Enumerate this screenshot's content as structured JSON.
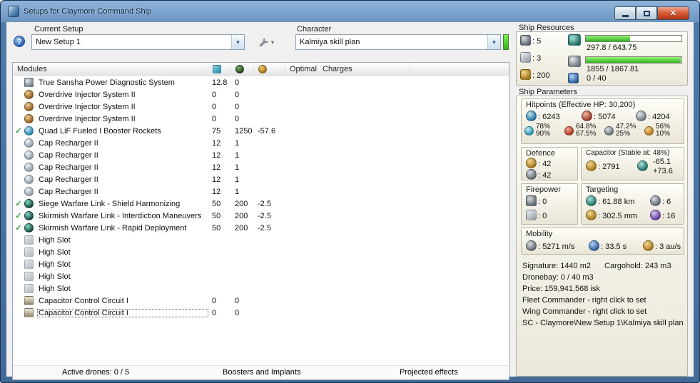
{
  "window": {
    "title": "Setups for Claymore Command Ship"
  },
  "toolbar": {
    "current_setup_label": "Current Setup",
    "setup_value": "New Setup 1",
    "character_label": "Character",
    "character_value": "Kalmiya skill plan",
    "help_glyph": "?"
  },
  "modules": {
    "header_label": "Modules",
    "optimal_label": "Optimal",
    "charges_label": "Charges",
    "rows": [
      {
        "check": "",
        "icon": "power-diagnostic",
        "name": "True Sansha Power Diagnostic System",
        "cpu": "12.8",
        "pg": "0",
        "cap": "",
        "optimal": "",
        "charges": ""
      },
      {
        "check": "",
        "icon": "overdrive",
        "name": "Overdrive Injector System II",
        "cpu": "0",
        "pg": "0",
        "cap": "",
        "optimal": "",
        "charges": ""
      },
      {
        "check": "",
        "icon": "overdrive",
        "name": "Overdrive Injector System II",
        "cpu": "0",
        "pg": "0",
        "cap": "",
        "optimal": "",
        "charges": ""
      },
      {
        "check": "",
        "icon": "overdrive",
        "name": "Overdrive Injector System II",
        "cpu": "0",
        "pg": "0",
        "cap": "",
        "optimal": "",
        "charges": ""
      },
      {
        "check": "✓",
        "icon": "booster",
        "name": "Quad LiF Fueled I Booster Rockets",
        "cpu": "75",
        "pg": "1250",
        "cap": "-57.6",
        "optimal": "",
        "charges": ""
      },
      {
        "check": "",
        "icon": "cap-recharger",
        "name": "Cap Recharger II",
        "cpu": "12",
        "pg": "1",
        "cap": "",
        "optimal": "",
        "charges": ""
      },
      {
        "check": "",
        "icon": "cap-recharger",
        "name": "Cap Recharger II",
        "cpu": "12",
        "pg": "1",
        "cap": "",
        "optimal": "",
        "charges": ""
      },
      {
        "check": "",
        "icon": "cap-recharger",
        "name": "Cap Recharger II",
        "cpu": "12",
        "pg": "1",
        "cap": "",
        "optimal": "",
        "charges": ""
      },
      {
        "check": "",
        "icon": "cap-recharger",
        "name": "Cap Recharger II",
        "cpu": "12",
        "pg": "1",
        "cap": "",
        "optimal": "",
        "charges": ""
      },
      {
        "check": "",
        "icon": "cap-recharger",
        "name": "Cap Recharger II",
        "cpu": "12",
        "pg": "1",
        "cap": "",
        "optimal": "",
        "charges": ""
      },
      {
        "check": "✓",
        "icon": "warfare-link",
        "name": "Siege Warfare Link - Shield Harmonizing",
        "cpu": "50",
        "pg": "200",
        "cap": "-2.5",
        "optimal": "",
        "charges": ""
      },
      {
        "check": "✓",
        "icon": "warfare-link",
        "name": "Skirmish Warfare Link - Interdiction Maneuvers",
        "cpu": "50",
        "pg": "200",
        "cap": "-2.5",
        "optimal": "",
        "charges": ""
      },
      {
        "check": "✓",
        "icon": "warfare-link",
        "name": "Skirmish Warfare Link - Rapid Deployment",
        "cpu": "50",
        "pg": "200",
        "cap": "-2.5",
        "optimal": "",
        "charges": ""
      },
      {
        "check": "",
        "icon": "high-slot",
        "name": "High Slot",
        "cpu": "",
        "pg": "",
        "cap": "",
        "optimal": "",
        "charges": ""
      },
      {
        "check": "",
        "icon": "high-slot",
        "name": "High Slot",
        "cpu": "",
        "pg": "",
        "cap": "",
        "optimal": "",
        "charges": ""
      },
      {
        "check": "",
        "icon": "high-slot",
        "name": "High Slot",
        "cpu": "",
        "pg": "",
        "cap": "",
        "optimal": "",
        "charges": ""
      },
      {
        "check": "",
        "icon": "high-slot",
        "name": "High Slot",
        "cpu": "",
        "pg": "",
        "cap": "",
        "optimal": "",
        "charges": ""
      },
      {
        "check": "",
        "icon": "high-slot",
        "name": "High Slot",
        "cpu": "",
        "pg": "",
        "cap": "",
        "optimal": "",
        "charges": ""
      },
      {
        "check": "",
        "icon": "rig",
        "name": "Capacitor Control Circuit I",
        "cpu": "0",
        "pg": "0",
        "cap": "",
        "optimal": "",
        "charges": ""
      },
      {
        "check": "",
        "icon": "rig",
        "name": "Capacitor Control Circuit I",
        "cpu": "0",
        "pg": "0",
        "cap": "",
        "optimal": "",
        "charges": "",
        "selected": true
      }
    ]
  },
  "bottom_tabs": [
    "Active drones: 0 / 5",
    "Boosters and Implants",
    "Projected effects"
  ],
  "resources": {
    "title": "Ship Resources",
    "turrets": ": 5",
    "launchers": ": 3",
    "ammo": ": 200",
    "cpu_text": "297.8 / 643.75",
    "pg_text": "1855 / 1867.81",
    "calibration_text": "0 / 40",
    "cpu_pct": 46,
    "pg_pct": 99
  },
  "parameters": {
    "title": "Ship Parameters",
    "hitpoints": {
      "title": "Hitpoints (Effective HP: 30,200)",
      "shield": ": 6243",
      "armor": ": 5074",
      "hull": ": 4204",
      "resists": [
        {
          "icon": "em",
          "top": "78%",
          "bottom": "90%"
        },
        {
          "icon": "thermal",
          "top": "64.8%",
          "bottom": "67.5%"
        },
        {
          "icon": "kinetic",
          "top": "47.2%",
          "bottom": "25%"
        },
        {
          "icon": "explosive",
          "top": "56%",
          "bottom": "10%"
        }
      ]
    },
    "defence": {
      "title": "Defence",
      "row1": ": 42",
      "row2": ": 42"
    },
    "capacitor": {
      "title": "Capacitor (Stable at: 48%)",
      "amount": ": 2791",
      "drain": "-65.1",
      "recharge": "+73.6"
    },
    "firepower": {
      "title": "Firepower",
      "row1": ": 0",
      "row2": ": 0"
    },
    "targeting": {
      "title": "Targeting",
      "range": ": 61.88 km",
      "max_targets": ": 6",
      "scan_res": ": 302.5 mm",
      "sensor": ": 16"
    },
    "mobility": {
      "title": "Mobility",
      "speed": ": 5271 m/s",
      "align": ": 33.5 s",
      "warp": ": 3 au/s"
    },
    "info": {
      "signature": "Signature: 1440 m2",
      "cargohold": "Cargohold: 243 m3",
      "dronebay": "Dronebay: 0 / 40 m3",
      "price": "Price: 159,941,568 isk",
      "fleet": "Fleet Commander - right click to set",
      "wing": "Wing Commander - right click to set",
      "path": "SC - Claymore\\New Setup 1\\Kalmiya skill plan"
    }
  }
}
